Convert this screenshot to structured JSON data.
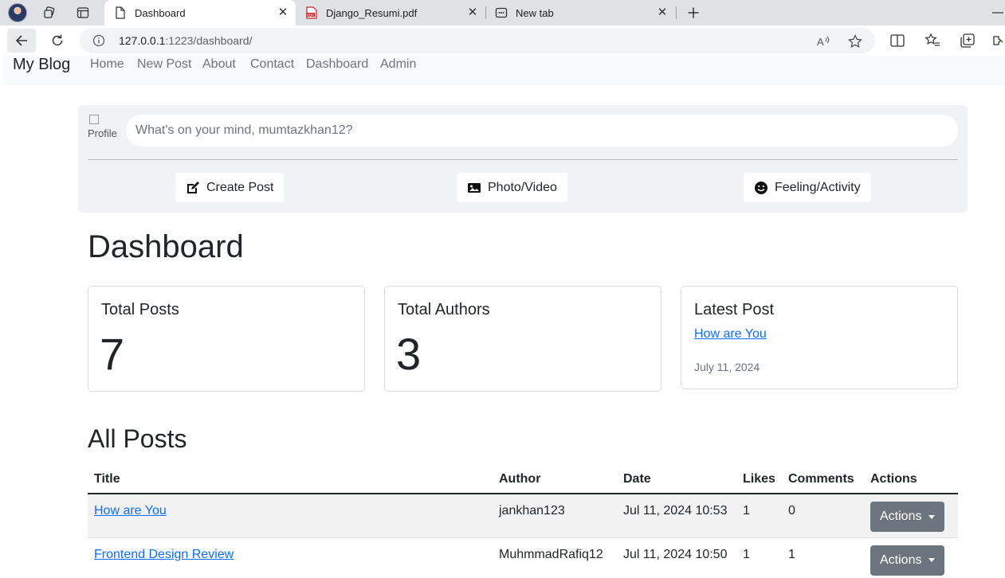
{
  "browser": {
    "tabs": [
      {
        "title": "Dashboard",
        "active": true
      },
      {
        "title": "Django_Resumi.pdf",
        "active": false
      },
      {
        "title": "New tab",
        "active": false
      }
    ],
    "url_host": "127.0.0.1",
    "url_rest": ":1223/dashboard/"
  },
  "navbar": {
    "brand": "My Blog",
    "links": [
      "Home",
      "New Post",
      "About",
      "Contact",
      "Dashboard",
      "Admin"
    ]
  },
  "composer": {
    "profile_alt": "Profile",
    "placeholder": "What's on your mind, mumtazkhan12?",
    "actions": [
      "Create Post",
      "Photo/Video",
      "Feeling/Activity"
    ]
  },
  "dashboard": {
    "heading": "Dashboard",
    "total_posts_label": "Total Posts",
    "total_posts": "7",
    "total_authors_label": "Total Authors",
    "total_authors": "3",
    "latest_post_label": "Latest Post",
    "latest_post_title": "How are You",
    "latest_post_date": "July 11, 2024"
  },
  "all_posts": {
    "heading": "All Posts",
    "columns": [
      "Title",
      "Author",
      "Date",
      "Likes",
      "Comments",
      "Actions"
    ],
    "rows": [
      {
        "title": "How are You",
        "author": "jankhan123",
        "date": "Jul 11, 2024 10:53",
        "likes": "1",
        "comments": "0",
        "action": "Actions"
      },
      {
        "title": "Frontend Design Review",
        "author": "MuhmmadRafiq12",
        "date": "Jul 11, 2024 10:50",
        "likes": "1",
        "comments": "1",
        "action": "Actions"
      }
    ]
  }
}
